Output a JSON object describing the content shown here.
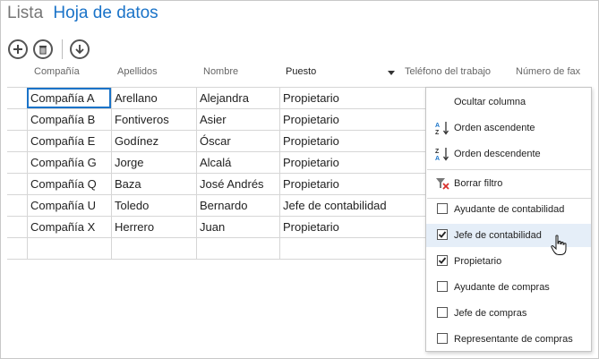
{
  "title": {
    "list_label": "Lista",
    "view_label": "Hoja de datos"
  },
  "columns": [
    "Compañía",
    "Apellidos",
    "Nombre",
    "Puesto",
    "Teléfono del trabajo",
    "Número de fax"
  ],
  "rows": [
    [
      "Compañía A",
      "Arellano",
      "Alejandra",
      "Propietario"
    ],
    [
      "Compañía B",
      "Fontiveros",
      "Asier",
      "Propietario"
    ],
    [
      "Compañía E",
      "Godínez",
      "Óscar",
      "Propietario"
    ],
    [
      "Compañía G",
      "Jorge",
      "Alcalá",
      "Propietario"
    ],
    [
      "Compañía Q",
      "Baza",
      "José Andrés",
      "Propietario"
    ],
    [
      "Compañía U",
      "Toledo",
      "Bernardo",
      "Jefe de contabilidad"
    ],
    [
      "Compañía X",
      "Herrero",
      "Juan",
      "Propietario"
    ]
  ],
  "menu": {
    "hide_column": "Ocultar columna",
    "sort_asc": "Orden ascendente",
    "sort_desc": "Orden descendente",
    "clear_filter": "Borrar filtro",
    "filters": [
      {
        "label": "Ayudante de contabilidad",
        "checked": false
      },
      {
        "label": "Jefe de contabilidad",
        "checked": true
      },
      {
        "label": "Propietario",
        "checked": true
      },
      {
        "label": "Ayudante de compras",
        "checked": false
      },
      {
        "label": "Jefe de compras",
        "checked": false
      },
      {
        "label": "Representante de compras",
        "checked": false
      }
    ]
  },
  "colors": {
    "accent": "#1a73c8",
    "highlight": "#e5eef8"
  },
  "icons": [
    "add-icon",
    "delete-icon",
    "download-icon",
    "sort-ascending-icon",
    "sort-descending-icon",
    "clear-filter-icon",
    "hand-cursor-icon"
  ]
}
